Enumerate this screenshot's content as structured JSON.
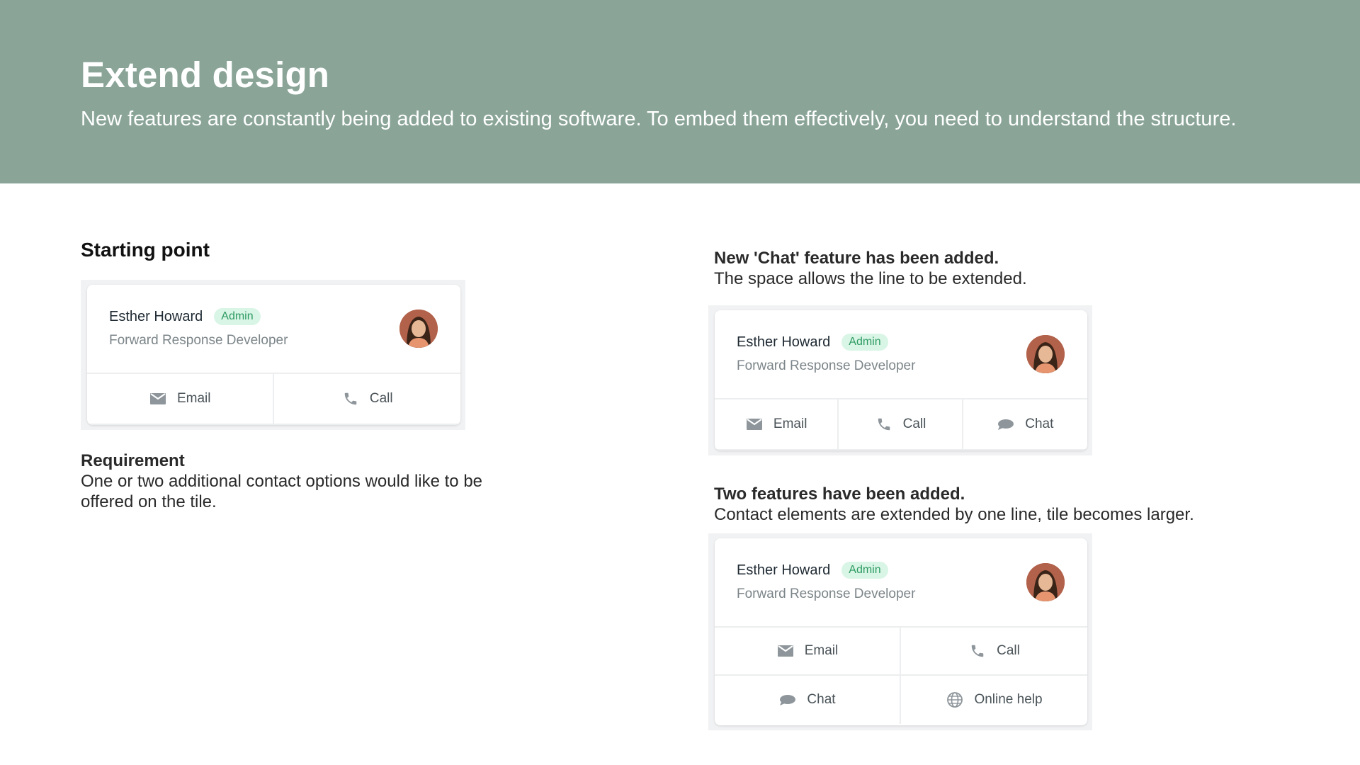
{
  "header": {
    "title": "Extend design",
    "subtitle": "New features are constantly being added to existing software. To embed them effectively, you need to understand the structure."
  },
  "left": {
    "section_title": "Starting point",
    "requirement_title": "Requirement",
    "requirement_text": "One or two additional contact options would like to be offered on the tile."
  },
  "right_top": {
    "title": "New 'Chat' feature has been added.",
    "text": "The space allows the line to be extended."
  },
  "right_bottom": {
    "title": "Two features have been added.",
    "text": "Contact elements are extended by one line, tile becomes larger."
  },
  "card": {
    "name": "Esther Howard",
    "badge": "Admin",
    "role": "Forward Response Developer"
  },
  "buttons": {
    "email": "Email",
    "call": "Call",
    "chat": "Chat",
    "online_help": "Online help"
  },
  "icons": {
    "email": "envelope-icon",
    "call": "phone-icon",
    "chat": "chat-bubble-icon",
    "online_help": "globe-icon"
  },
  "colors": {
    "header_bg": "#8aa598",
    "badge_bg": "#d9f5e6",
    "badge_text": "#2d9b62",
    "icon": "#8e969b"
  }
}
